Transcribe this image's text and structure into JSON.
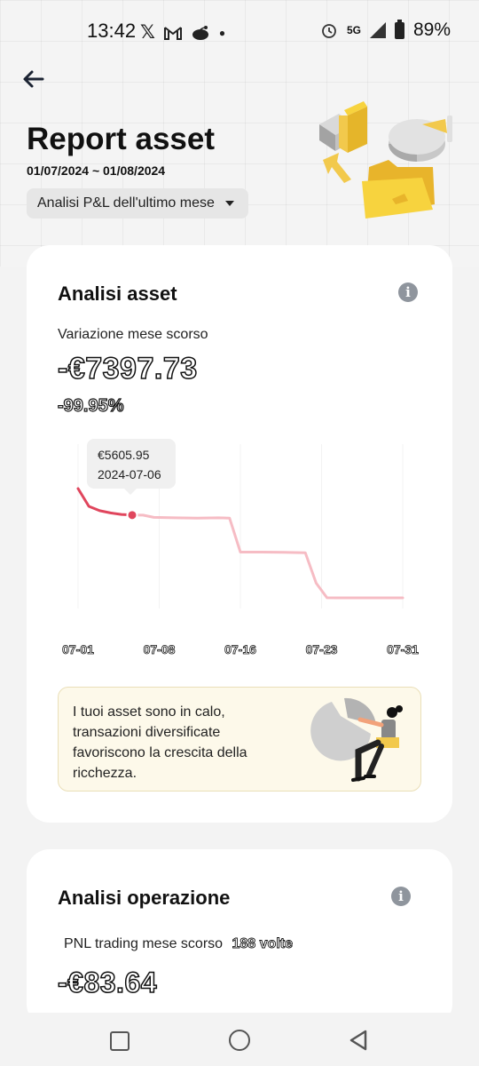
{
  "status_bar": {
    "time": "13:42",
    "network": "5G",
    "battery": "89%",
    "icons": [
      "x-icon",
      "gmail-icon",
      "reddit-icon",
      "dot-icon",
      "alarm-icon",
      "signal-icon",
      "battery-icon"
    ]
  },
  "header": {
    "title": "Report asset",
    "date_range": "01/07/2024 ~ 01/08/2024",
    "period_selector": "Analisi P&L dell'ultimo mese"
  },
  "asset_card": {
    "title": "Analisi asset",
    "change_label": "Variazione mese scorso",
    "change_value": "-€7397.73",
    "change_percent": "-99.95%",
    "tooltip_value": "€5605.95",
    "tooltip_date": "2024-07-06",
    "banner_text": "I tuoi asset sono in calo, transazioni diversificate favoriscono la crescita della ricchezza."
  },
  "chart_data": {
    "type": "line",
    "x_ticks": [
      "07-01",
      "07-08",
      "07-16",
      "07-23",
      "07-31"
    ],
    "series": [
      {
        "x": [
          "07-01",
          "07-02",
          "07-03",
          "07-04",
          "07-05",
          "07-06",
          "07-07",
          "07-08",
          "07-10",
          "07-12",
          "07-14",
          "07-15",
          "07-16",
          "07-18",
          "07-20",
          "07-22",
          "07-23",
          "07-24",
          "07-26",
          "07-28",
          "07-31"
        ],
        "values": [
          7400,
          6200,
          5900,
          5750,
          5650,
          5605.95,
          5600,
          5450,
          5420,
          5400,
          5420,
          5400,
          3100,
          3100,
          3080,
          3060,
          1000,
          10,
          5,
          4,
          3.5
        ]
      }
    ],
    "highlighted_point": {
      "x": "2024-07-06",
      "value": 5605.95
    },
    "colors": {
      "solid": "#e0465d",
      "faded": "#f6bcc4"
    },
    "grid": true
  },
  "trade_card": {
    "title": "Analisi operazione",
    "pnl_label": "PNL trading mese scorso",
    "trade_count": "188 volte",
    "pnl_value": "-€83.64"
  },
  "nav_bar": {
    "buttons": [
      "recent-apps",
      "home",
      "back"
    ]
  },
  "colors": {
    "accent_red": "#e0465d",
    "accent_yellow": "#f2c94c",
    "card_bg": "#ffffff",
    "page_bg": "#f3f3f3"
  }
}
